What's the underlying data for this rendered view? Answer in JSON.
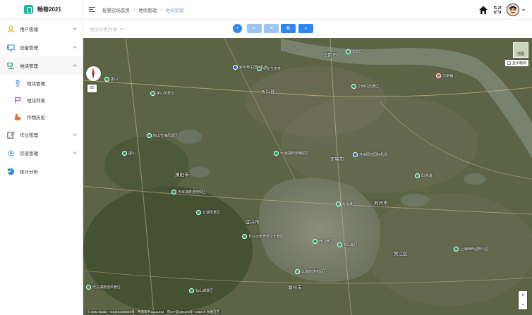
{
  "app": {
    "name": "畅巷2021"
  },
  "sidebar": {
    "groups": [
      {
        "label": "用户管理",
        "icon": "user-icon",
        "open": false
      },
      {
        "label": "设备管理",
        "icon": "monitor-icon",
        "open": false
      },
      {
        "label": "地块管理",
        "icon": "land-icon",
        "open": true,
        "items": [
          {
            "label": "地块管理",
            "icon": "land-pin-icon"
          },
          {
            "label": "地块列表",
            "icon": "flag-icon"
          },
          {
            "label": "作物历史",
            "icon": "crop-history-icon"
          }
        ]
      },
      {
        "label": "作业管理",
        "icon": "edit-icon",
        "open": false
      },
      {
        "label": "农资管理",
        "icon": "gear-icon",
        "open": false
      },
      {
        "label": "统计分析",
        "icon": "pie-chart-icon",
        "open": false
      }
    ]
  },
  "breadcrumb": [
    "智慧农场首页",
    "地块管理",
    "地块管理"
  ],
  "toolbar": {
    "plot_select_placeholder": "地块分类列表",
    "buttons": [
      {
        "name": "add",
        "glyph": "+"
      },
      {
        "name": "edit",
        "glyph": "✓"
      },
      {
        "name": "delete",
        "glyph": "✕"
      },
      {
        "name": "copy",
        "glyph": "⧉"
      },
      {
        "name": "search",
        "glyph": "⌕"
      }
    ]
  },
  "map": {
    "view_2d": "2D",
    "map_type_label": "地图",
    "road_toggle_label": "显示路网",
    "zoom_in": "+",
    "zoom_out": "−",
    "copyright": "© 2022 Baidu - GS(2021)6026号 - 甲测资字11111342 - 京ICP证030173号 - Data © 长地万方",
    "scale": "Baidu",
    "cities": [
      "溧阳市",
      "宜兴市",
      "无锡市",
      "苏州市",
      "湖州市",
      "长兴县",
      "吴江区",
      "江阴市"
    ],
    "pois": [
      {
        "label": "茅山风景区",
        "color": "green"
      },
      {
        "label": "南山竹海风景区",
        "color": "green"
      },
      {
        "label": "天目湖旅游度假区",
        "color": "green"
      },
      {
        "label": "云湖风景区",
        "color": "green"
      },
      {
        "label": "大浦湖旅游度假区",
        "color": "green"
      },
      {
        "label": "西山景区",
        "color": "green"
      },
      {
        "label": "东山景区",
        "color": "green"
      },
      {
        "label": "光福景区",
        "color": "green"
      },
      {
        "label": "太湖旅游度假区",
        "color": "green"
      },
      {
        "label": "长兴大唐贡茶文化景区",
        "color": "green"
      },
      {
        "label": "天子湖旅游风景区",
        "color": "green"
      },
      {
        "label": "仙山湖景区",
        "color": "green"
      },
      {
        "label": "新龙生态林",
        "color": "green"
      },
      {
        "label": "华西村风景区",
        "color": "green"
      },
      {
        "label": "恐龙园",
        "color": "green"
      },
      {
        "label": "常州奔牛国际机场",
        "color": "blue"
      },
      {
        "label": "苏南硕放国际机场",
        "color": "blue"
      },
      {
        "label": "上海西西湿野公园",
        "color": "green"
      },
      {
        "label": "香山",
        "color": "green"
      },
      {
        "label": "虞山",
        "color": "green"
      },
      {
        "label": "阳澄湖",
        "color": "green"
      },
      {
        "label": "沈家铺",
        "color": "pink"
      }
    ]
  }
}
